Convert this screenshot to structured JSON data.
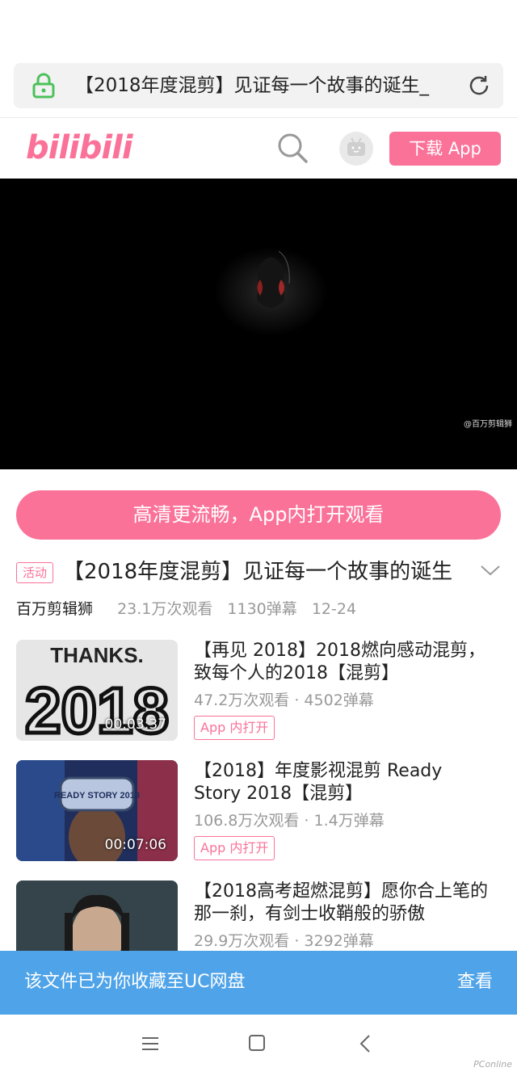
{
  "browser": {
    "address_text": "【2018年度混剪】见证每一个故事的诞生_"
  },
  "header": {
    "logo_text": "bilibili",
    "download_label": "下载 App"
  },
  "player": {
    "watermark": "@百万剪辑狮"
  },
  "open_app_label": "高清更流畅，App内打开观看",
  "video": {
    "tag": "活动",
    "title": "【2018年度混剪】见证每一个故事的诞生",
    "author": "百万剪辑狮",
    "views": "23.1万次观看",
    "danmaku": "1130弹幕",
    "date": "12-24"
  },
  "recommendations": [
    {
      "title": "【再见 2018】2018燃向感动混剪，致每个人的2018【混剪】",
      "meta": "47.2万次观看 · 4502弹幕",
      "duration": "00:03:37",
      "open_label": "App 内打开",
      "thumb_text_top": "THANKS.",
      "thumb_text_main": "2018"
    },
    {
      "title": "【2018】年度影视混剪 Ready Story 2018【混剪】",
      "meta": "106.8万次观看 · 1.4万弹幕",
      "duration": "00:07:06",
      "open_label": "App 内打开",
      "thumb_text_main": "READY STORY 2018"
    },
    {
      "title": "【2018高考超燃混剪】愿你合上笔的那一刹，有剑士收鞘般的骄傲",
      "meta": "29.9万次观看 · 3292弹幕"
    }
  ],
  "toast": {
    "message": "该文件已为你收藏至UC网盘",
    "action": "查看"
  },
  "corner_mark": "PConline",
  "colors": {
    "brand_pink": "#fb7299",
    "toast_blue": "#4fa3e8",
    "lock_green": "#4cc15a"
  }
}
